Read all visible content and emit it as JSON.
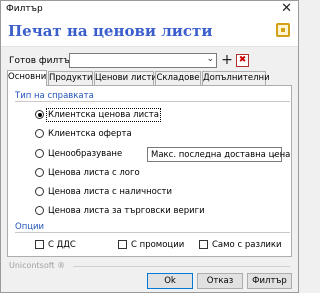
{
  "window": {
    "title": "Филтър",
    "close_glyph": "✕"
  },
  "header": {
    "heading": "Печат на ценови листи",
    "icon": "app-icon"
  },
  "filter": {
    "label": "Готов филтър:",
    "value": "",
    "add_glyph": "+",
    "delete_glyph": "✖"
  },
  "tabs": [
    {
      "label": "Основни",
      "active": true
    },
    {
      "label": "Продукти",
      "active": false
    },
    {
      "label": "Ценови листи",
      "active": false
    },
    {
      "label": "Складове",
      "active": false
    },
    {
      "label": "Допълнителни",
      "active": false
    }
  ],
  "report_type": {
    "title": "Тип на справката",
    "options": [
      {
        "label": "Клиентска ценова листа",
        "checked": true
      },
      {
        "label": "Клиентска оферта",
        "checked": false
      },
      {
        "label": "Ценообразуване",
        "checked": false
      },
      {
        "label": "Ценова листа с лого",
        "checked": false
      },
      {
        "label": "Ценова листа с наличности",
        "checked": false
      },
      {
        "label": "Ценова листа за търговски вериги",
        "checked": false
      }
    ],
    "pricing_select": "Макс. последна доставна цена"
  },
  "options": {
    "title": "Опции",
    "checkboxes": [
      {
        "label": "С ДДС",
        "checked": false
      },
      {
        "label": "С промоции",
        "checked": false
      },
      {
        "label": "Само с разлики",
        "checked": false
      }
    ]
  },
  "footer": {
    "vendor": "Unicontsoft ®",
    "ok_label": "Ok",
    "cancel_label": "Отказ",
    "filter_label": "Филтър"
  }
}
